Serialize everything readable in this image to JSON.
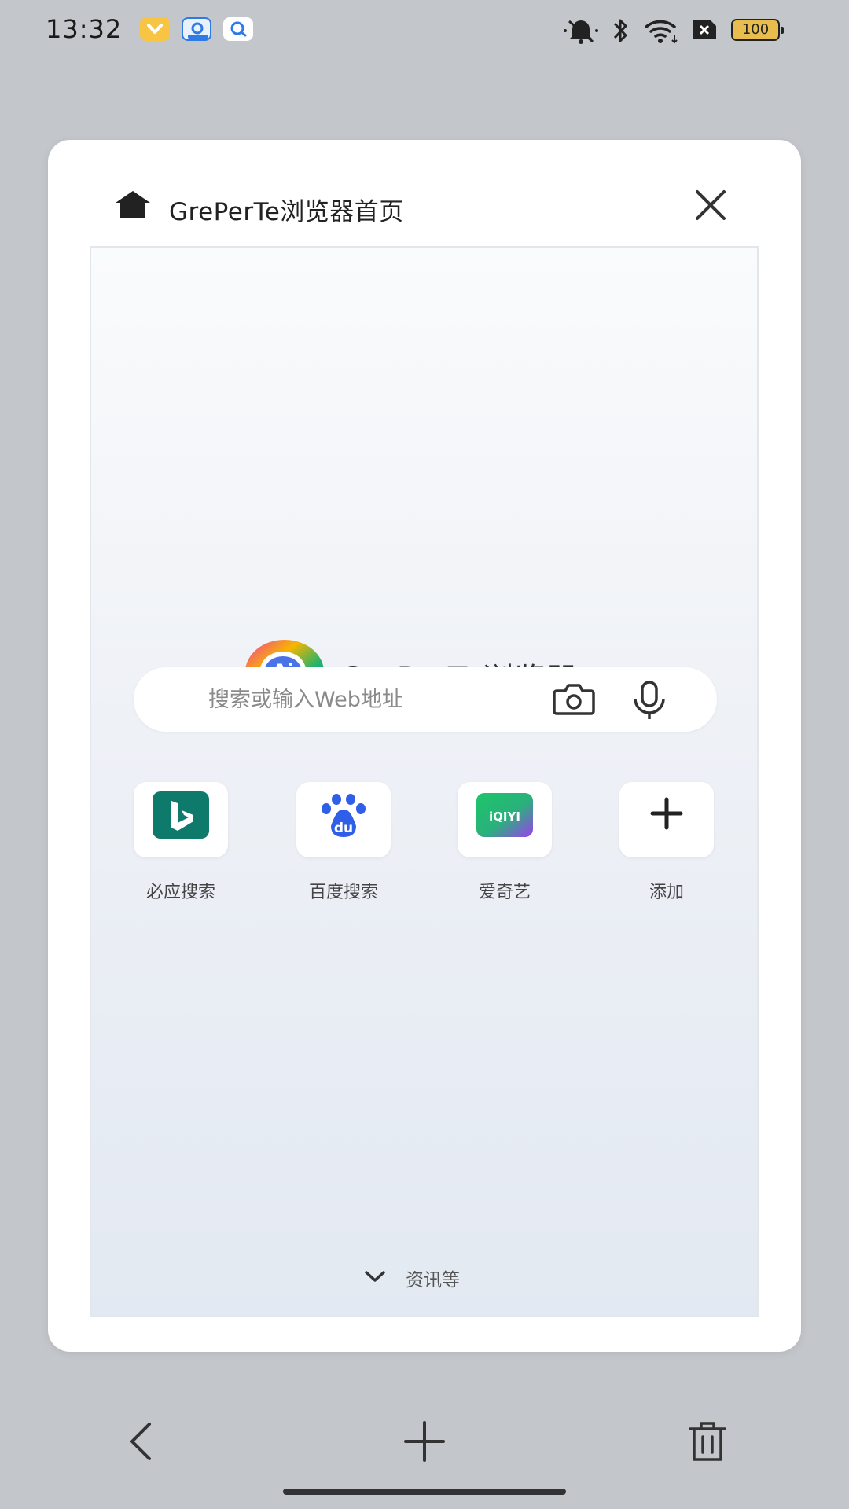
{
  "status_bar": {
    "time": "13:32",
    "battery_level": "100",
    "notification_icons": [
      "notification-app-icon-yellow",
      "notification-app-icon-blue",
      "notification-app-icon-search"
    ],
    "system_icons": [
      "mute-icon",
      "bluetooth-icon",
      "wifi-icon",
      "sim-disabled-icon",
      "battery-icon"
    ]
  },
  "tab_card": {
    "title": "GrePerTe浏览器首页",
    "icon": "home-icon",
    "close_icon": "close-icon"
  },
  "browser_home": {
    "brand_name": "GrePerTe浏览器",
    "logo_text": "Ai",
    "search": {
      "placeholder": "搜索或输入Web地址",
      "value": ""
    },
    "quick_links": [
      {
        "label": "必应搜索",
        "icon": "bing-icon"
      },
      {
        "label": "百度搜索",
        "icon": "baidu-icon",
        "icon_text": "du"
      },
      {
        "label": "爱奇艺",
        "icon": "iqiyi-icon",
        "icon_text": "iQIYI"
      },
      {
        "label": "添加",
        "icon": "plus-icon"
      }
    ],
    "feed_toggle_label": "资讯等"
  },
  "toolbar": {
    "back_icon": "back-icon",
    "new_tab_icon": "plus-icon",
    "delete_icon": "trash-icon"
  },
  "colors": {
    "background": "#c3c6ca",
    "card": "#ffffff",
    "bing_green": "#0e7a6c",
    "baidu_blue": "#2f5ee8",
    "battery": "#e8bd4e"
  }
}
